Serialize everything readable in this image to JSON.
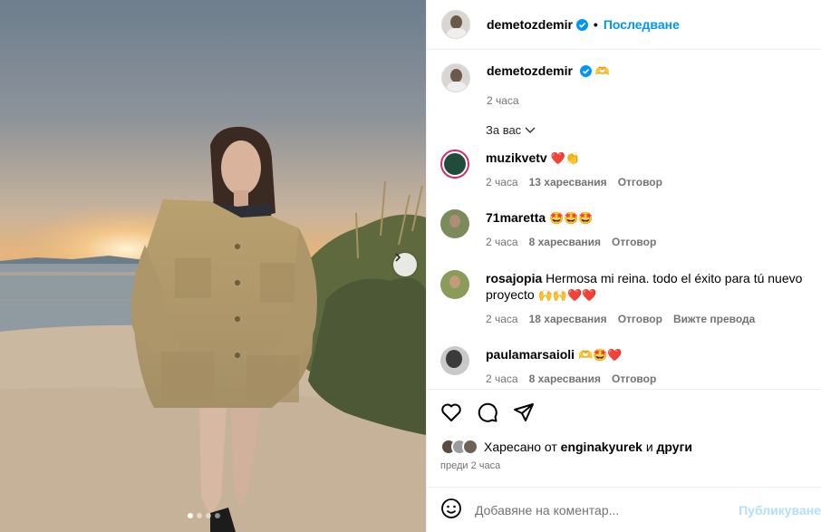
{
  "post": {
    "author": "demetozdemir",
    "follow_label": "Последване",
    "separator": "•",
    "caption_emoji": "🫶",
    "caption_time": "2 часа",
    "image_dots": 4,
    "active_dot": 1
  },
  "sort_label": "За вас",
  "comments": [
    {
      "user": "muzikvetv",
      "text": "",
      "emoji": "❤️👏",
      "time": "2 часа",
      "likes": "13 харесвания",
      "reply": "Отговор",
      "avatar_color": "#1f4d3a"
    },
    {
      "user": "71maretta",
      "text": "",
      "emoji": "🤩🤩🤩",
      "time": "2 часа",
      "likes": "8 харесвания",
      "reply": "Отговор",
      "avatar_color": "#7c8b5c"
    },
    {
      "user": "rosajopia",
      "text": "Hermosa mi reina. todo el éxito para tú nuevo proyecto",
      "emoji": "🙌🙌❤️❤️",
      "time": "2 часа",
      "likes": "18 харесвания",
      "reply": "Отговор",
      "translate": "Вижте превода",
      "avatar_color": "#8a9b5a"
    },
    {
      "user": "paulamarsaioli",
      "text": "",
      "emoji": "🫶🤩❤️",
      "time": "2 часа",
      "likes": "8 харесвания",
      "reply": "Отговор",
      "avatar_color": "#6f6f6f"
    }
  ],
  "actions": {
    "like_icon": "heart-icon",
    "comment_icon": "comment-icon",
    "share_icon": "send-icon"
  },
  "liked_by": {
    "prefix": "Харесано от",
    "user": "enginakyurek",
    "conj": "и",
    "others": "други"
  },
  "posted_time": "преди 2 часа",
  "add_comment": {
    "placeholder": "Добавяне на коментар...",
    "publish_label": "Публикуване"
  },
  "colors": {
    "accent": "#0095f6",
    "verified": "#0095f6",
    "heart": "#ff3040",
    "publish_disabled": "#b2dffc"
  }
}
